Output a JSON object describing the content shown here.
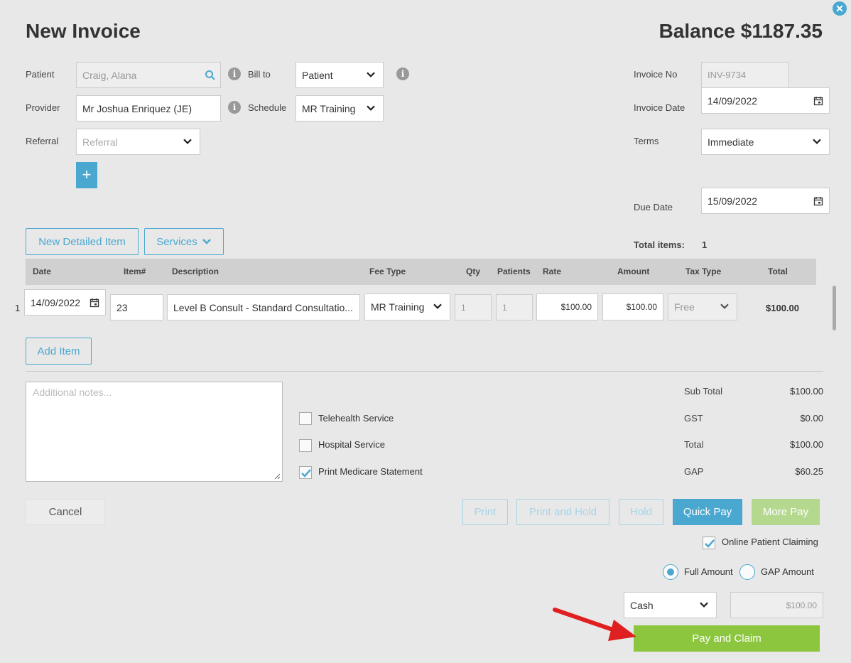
{
  "header": {
    "title": "New Invoice",
    "balance": "Balance $1187.35"
  },
  "icons": {
    "close": "close-icon",
    "search": "search-icon",
    "info": "info-icon",
    "chevron": "chevron-down-icon",
    "calendar": "calendar-icon",
    "plus": "plus-icon",
    "resize": "resize-grip-icon"
  },
  "form": {
    "patient_label": "Patient",
    "patient_value": "Craig, Alana",
    "bill_to_label": "Bill to",
    "bill_to_value": "Patient",
    "provider_label": "Provider",
    "provider_value": "Mr Joshua Enriquez (JE)",
    "schedule_label": "Schedule",
    "schedule_value": "MR Training",
    "referral_label": "Referral",
    "referral_placeholder": "Referral",
    "add_symbol": "+",
    "invoice_no_label": "Invoice No",
    "invoice_no_value": "INV-9734",
    "invoice_date_label": "Invoice Date",
    "invoice_date_value": "14/09/2022",
    "terms_label": "Terms",
    "terms_value": "Immediate",
    "due_date_label": "Due Date",
    "due_date_value": "15/09/2022",
    "total_items_label": "Total items:",
    "total_items_value": "1"
  },
  "toolbar": {
    "new_detailed_item": "New Detailed Item",
    "services": "Services"
  },
  "table": {
    "headers": [
      "Date",
      "Item#",
      "Description",
      "Fee Type",
      "Qty",
      "Patients",
      "Rate",
      "Amount",
      "Tax Type",
      "Total"
    ],
    "rows": [
      {
        "index": "1",
        "date": "14/09/2022",
        "item": "23",
        "description": "Level B Consult - Standard Consultatio...",
        "fee_type": "MR Training",
        "qty": "1",
        "patients": "1",
        "rate": "$100.00",
        "amount": "$100.00",
        "tax_type": "Free",
        "total": "$100.00"
      }
    ]
  },
  "add_item": "Add Item",
  "notes": {
    "placeholder": "Additional notes..."
  },
  "options": {
    "telehealth": {
      "label": "Telehealth Service",
      "checked": false
    },
    "hospital": {
      "label": "Hospital Service",
      "checked": false
    },
    "medicare": {
      "label": "Print Medicare Statement",
      "checked": true
    }
  },
  "totals": {
    "sub_total_label": "Sub Total",
    "sub_total": "$100.00",
    "gst_label": "GST",
    "gst": "$0.00",
    "total_label": "Total",
    "total": "$100.00",
    "gap_label": "GAP",
    "gap": "$60.25"
  },
  "actions": {
    "cancel": "Cancel",
    "print": "Print",
    "print_and_hold": "Print and Hold",
    "hold": "Hold",
    "quick_pay": "Quick Pay",
    "more_pay": "More Pay"
  },
  "claiming": {
    "online_label": "Online Patient Claiming",
    "online_checked": true,
    "full_amount": "Full Amount",
    "gap_amount": "GAP Amount",
    "selected": "Full Amount",
    "payment_method": "Cash",
    "payment_amount": "$100.00",
    "pay_and_claim": "Pay and Claim"
  },
  "colors": {
    "accent": "#4aa8d0",
    "green": "#8cc63f",
    "light_green": "#b5d88f",
    "arrow": "#e02020"
  }
}
